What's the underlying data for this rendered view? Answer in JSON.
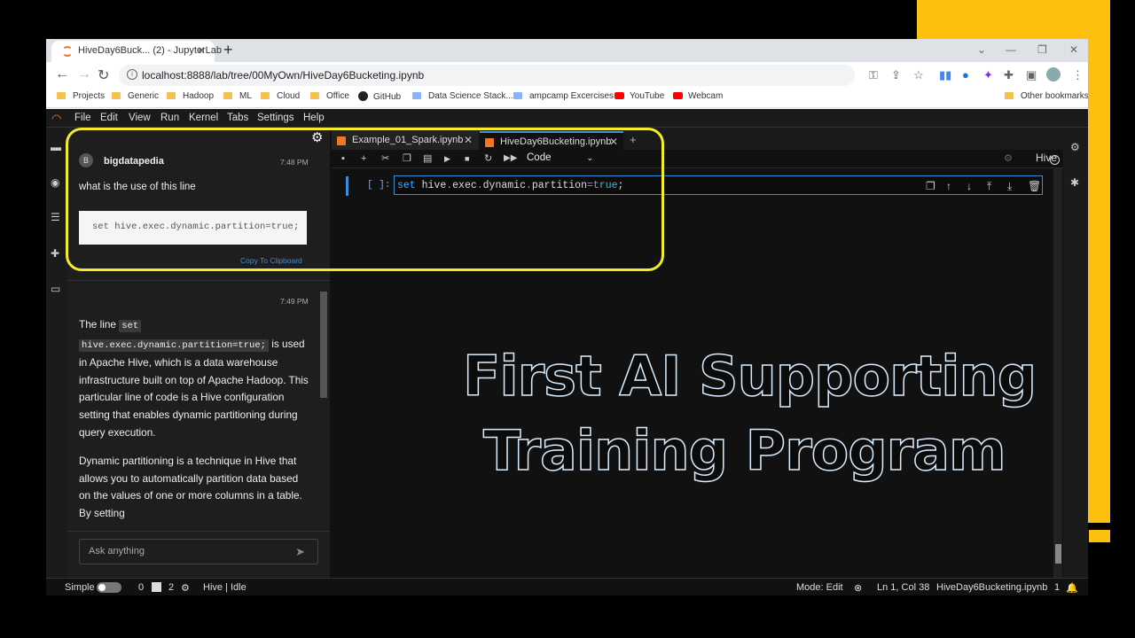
{
  "browser": {
    "tab_title": "HiveDay6Buck... (2) - JupyterLab",
    "url": "localhost:8888/lab/tree/00MyOwn/HiveDay6Bucketing.ipynb"
  },
  "bookmarks": [
    {
      "label": "Projects"
    },
    {
      "label": "Generic"
    },
    {
      "label": "Hadoop"
    },
    {
      "label": "ML"
    },
    {
      "label": "Cloud"
    },
    {
      "label": "Office"
    },
    {
      "label": "GitHub"
    },
    {
      "label": "Data Science Stack..."
    },
    {
      "label": "ampcamp Excercises"
    },
    {
      "label": "YouTube"
    },
    {
      "label": "Webcam"
    }
  ],
  "other_bookmarks": "Other bookmarks",
  "menu": [
    "File",
    "Edit",
    "View",
    "Run",
    "Kernel",
    "Tabs",
    "Settings",
    "Help"
  ],
  "chat": {
    "user_avatar": "B",
    "user_name": "bigdatapedia",
    "time1": "7:48 PM",
    "question": "what is the use of this line",
    "code": "set hive.exec.dynamic.partition=true;",
    "copy": "Copy To Clipboard",
    "time2": "7:49 PM",
    "answer_p1_a": "The line ",
    "answer_code1": "set",
    "answer_code2": "hive.exec.dynamic.partition=true;",
    "answer_p1_b": " is used in Apache Hive, which is a data warehouse infrastructure built on top of Apache Hadoop. This particular line of code is a Hive configuration setting that enables dynamic partitioning during query execution.",
    "answer_p2": "Dynamic partitioning is a technique in Hive that allows you to automatically partition data based on the values of one or more columns in a table. By setting",
    "input_placeholder": "Ask anything"
  },
  "notebook": {
    "tabs": [
      {
        "label": "Example_01_Spark.ipynb"
      },
      {
        "label": "HiveDay6Bucketing.ipynb"
      }
    ],
    "cell_type": "Code",
    "kernel": "Hive",
    "prompt": "[ ]:",
    "code": {
      "kw": "set",
      "a": " hive",
      "d1": ".",
      "b": "exec",
      "d2": ".",
      "c": "dynamic",
      "d3": ".",
      "e": "partition",
      "eq": "=",
      "val": "true",
      "end": ";"
    }
  },
  "status": {
    "simple": "Simple",
    "n0": "0",
    "n2": "2",
    "kernel_status": "Hive | Idle",
    "mode": "Mode: Edit",
    "pos": "Ln 1, Col 38",
    "file": "HiveDay6Bucketing.ipynb",
    "count": "1"
  },
  "overlay": {
    "line1": "First AI Supporting",
    "line2": "Training Program"
  },
  "colors": {
    "yellow": "#fdc00f",
    "highlight": "#f5ea2b",
    "jupyter_orange": "#f37626",
    "accent_blue": "#3b8ed8"
  }
}
